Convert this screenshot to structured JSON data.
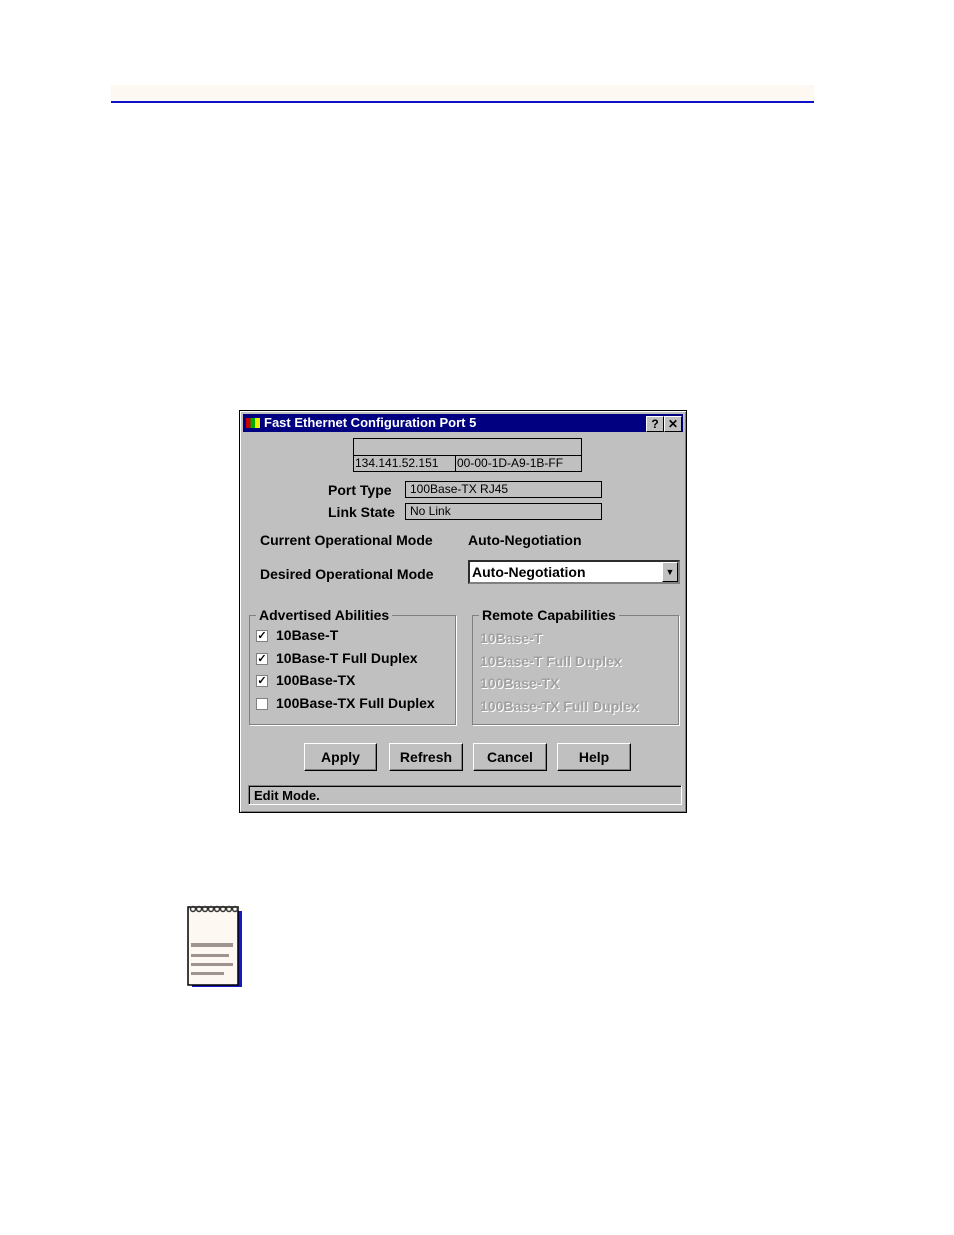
{
  "dialog": {
    "title": "Fast Ethernet Configuration Port  5",
    "help_btn": "?",
    "close_btn": "✕",
    "ip_address": "134.141.52.151",
    "mac_address": "00-00-1D-A9-1B-FF",
    "name_field": "",
    "port_type_label": "Port Type",
    "port_type": "100Base-TX RJ45",
    "link_state_label": "Link State",
    "link_state": "No Link",
    "current_mode_label": "Current Operational Mode",
    "current_mode": "Auto-Negotiation",
    "desired_mode_label": "Desired Operational Mode",
    "desired_mode": "Auto-Negotiation",
    "advertised": {
      "title": "Advertised Abilities",
      "items": [
        {
          "label": "10Base-T",
          "checked": true
        },
        {
          "label": "10Base-T Full Duplex",
          "checked": true
        },
        {
          "label": "100Base-TX",
          "checked": true
        },
        {
          "label": "100Base-TX Full Duplex",
          "checked": false
        }
      ]
    },
    "remote": {
      "title": "Remote Capabilities",
      "items": [
        "10Base-T",
        "10Base-T Full Duplex",
        "100Base-TX",
        "100Base-TX Full Duplex"
      ]
    },
    "buttons": {
      "apply": "Apply",
      "refresh": "Refresh",
      "cancel": "Cancel",
      "help": "Help"
    },
    "status": "Edit Mode."
  },
  "colors": {
    "titlebar": "#000080",
    "header_rule": "#1010c8",
    "dialog_bg": "#c0c0c0"
  },
  "icons": {
    "note": "notepad-icon"
  }
}
